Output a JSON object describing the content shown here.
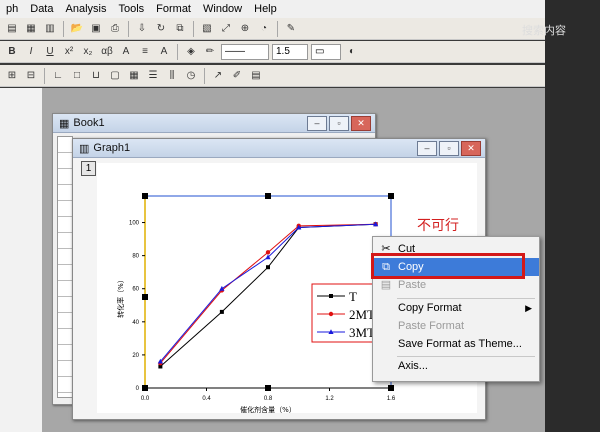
{
  "menu": {
    "items": [
      "ph",
      "Data",
      "Analysis",
      "Tools",
      "Format",
      "Window",
      "Help"
    ]
  },
  "toolbar": {
    "font_size": "1.5",
    "search_hint": "搜索内容"
  },
  "book": {
    "title": "Book1"
  },
  "graph": {
    "title": "Graph1",
    "layer_label": "1",
    "annotation": "不可行"
  },
  "chart_data": {
    "type": "line",
    "xlabel": "催化剂含量（%）",
    "ylabel": "转化率（%）",
    "xlim": [
      0,
      1.6
    ],
    "ylim": [
      0,
      110
    ],
    "x_ticks": [
      "0.0",
      "0.4",
      "0.8",
      "1.2",
      "1.6"
    ],
    "y_ticks": [
      "0",
      "20",
      "40",
      "60",
      "80",
      "100"
    ],
    "series": [
      {
        "name": "T",
        "color": "#000000",
        "marker": "square",
        "x": [
          0.1,
          0.5,
          0.8,
          1.0,
          1.5
        ],
        "y": [
          13,
          46,
          73,
          97,
          99
        ]
      },
      {
        "name": "2MT",
        "color": "#e01010",
        "marker": "circle",
        "x": [
          0.1,
          0.5,
          0.8,
          1.0,
          1.5
        ],
        "y": [
          15,
          59,
          82,
          98,
          99
        ]
      },
      {
        "name": "3MT",
        "color": "#1a1adc",
        "marker": "triangle",
        "x": [
          0.1,
          0.5,
          0.8,
          1.0,
          1.5
        ],
        "y": [
          16,
          60,
          79,
          97,
          99
        ]
      }
    ]
  },
  "context_menu": {
    "items": [
      "Cut",
      "Copy",
      "Paste",
      "Copy Format",
      "Paste Format",
      "Save Format as Theme...",
      "Axis..."
    ]
  }
}
